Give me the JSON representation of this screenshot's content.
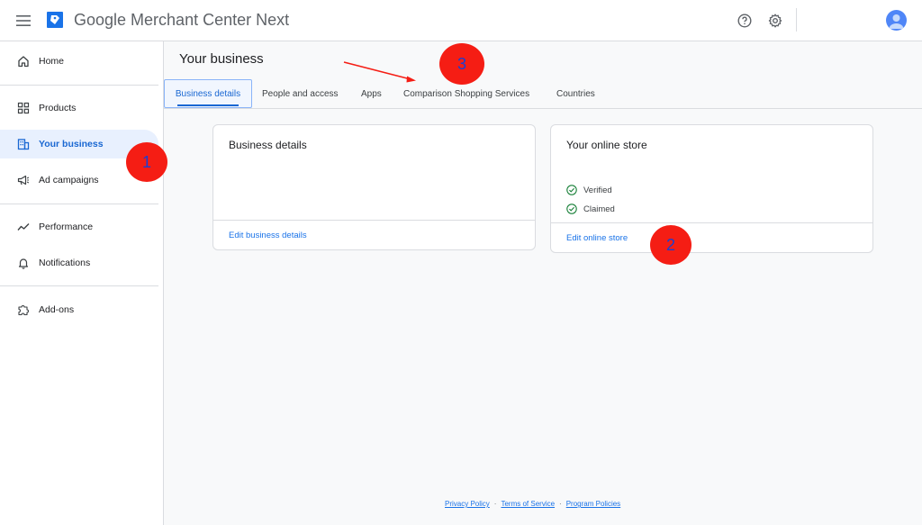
{
  "header": {
    "title_brand": "Google",
    "title_rest": " Merchant Center Next",
    "icons": [
      "menu-icon",
      "help-icon",
      "settings-icon",
      "account-avatar"
    ]
  },
  "sidebar": {
    "items": [
      {
        "label": "Home",
        "icon": "home-icon"
      },
      {
        "label": "Products",
        "icon": "products-grid-icon"
      },
      {
        "label": "Your business",
        "icon": "business-icon",
        "active": true
      },
      {
        "label": "Ad campaigns",
        "icon": "megaphone-icon"
      },
      {
        "label": "Performance",
        "icon": "trend-icon"
      },
      {
        "label": "Notifications",
        "icon": "bell-icon"
      },
      {
        "label": "Add-ons",
        "icon": "puzzle-icon"
      }
    ]
  },
  "main": {
    "title": "Your business",
    "tabs": [
      {
        "label": "Business details",
        "active": true
      },
      {
        "label": "People and access"
      },
      {
        "label": "Apps"
      },
      {
        "label": "Comparison Shopping Services"
      },
      {
        "label": "Countries"
      }
    ],
    "cards": {
      "business": {
        "title": "Business details",
        "link": "Edit business details"
      },
      "store": {
        "title": "Your online store",
        "statuses": [
          "Verified",
          "Claimed"
        ],
        "link": "Edit online store"
      }
    }
  },
  "footer": {
    "links": [
      "Privacy Policy",
      "Terms of Service",
      "Program Policies"
    ]
  },
  "annotations": {
    "badges": [
      "1",
      "2",
      "3"
    ]
  },
  "colors": {
    "accent": "#1a73e8",
    "active_bg": "#e8f0fe",
    "badge": "#f51d14",
    "badge_text": "#1b3fd1",
    "verified": "#188038"
  }
}
